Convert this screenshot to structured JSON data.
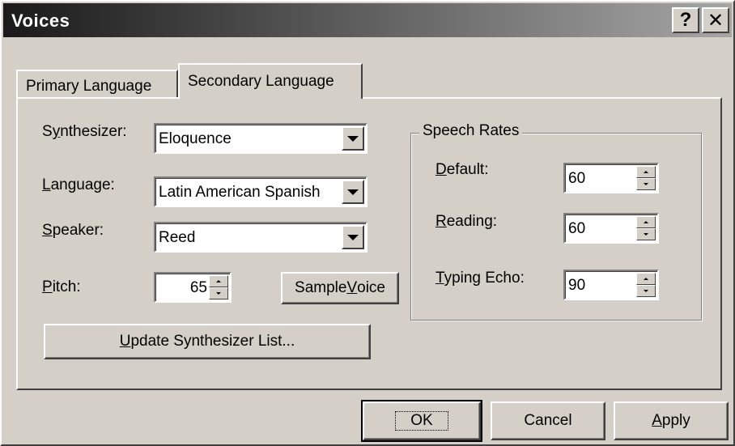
{
  "window": {
    "title": "Voices",
    "help_icon": "?",
    "close_icon": "✕"
  },
  "tabs": [
    {
      "label": "Primary Language",
      "selected": false
    },
    {
      "label": "Secondary Language",
      "selected": true
    }
  ],
  "synthesizer": {
    "label_pre": "S",
    "label_u": "y",
    "label_post": "nthesizer:",
    "value": "Eloquence"
  },
  "language": {
    "label_u": "L",
    "label_post": "anguage:",
    "value": "Latin American Spanish"
  },
  "speaker": {
    "label_u": "S",
    "label_post": "peaker:",
    "value": "Reed"
  },
  "pitch": {
    "label_u": "P",
    "label_post": "itch:",
    "value": "65"
  },
  "sample_voice": {
    "pre": "Sample ",
    "u": "V",
    "post": "oice"
  },
  "update_list": {
    "u": "U",
    "post": "pdate Synthesizer List..."
  },
  "speech_rates": {
    "title": "Speech Rates",
    "default": {
      "label_u": "D",
      "label_post": "efault:",
      "value": "60"
    },
    "reading": {
      "label_u": "R",
      "label_post": "eading:",
      "value": "60"
    },
    "typing_echo": {
      "label_u": "T",
      "label_post": "yping Echo:",
      "value": "90"
    }
  },
  "footer": {
    "ok": "OK",
    "cancel": "Cancel",
    "apply_u": "A",
    "apply_post": "pply"
  }
}
